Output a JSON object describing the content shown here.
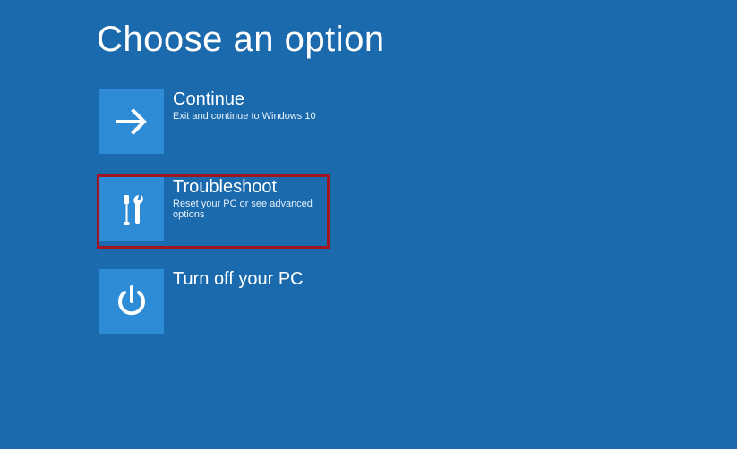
{
  "title": "Choose an option",
  "options": {
    "continue": {
      "title": "Continue",
      "subtitle": "Exit and continue to Windows 10"
    },
    "troubleshoot": {
      "title": "Troubleshoot",
      "subtitle": "Reset your PC or see advanced options"
    },
    "poweroff": {
      "title": "Turn off your PC"
    }
  },
  "colors": {
    "background": "#1a6aad",
    "tile": "#2e8cd6",
    "highlight": "#a11420"
  }
}
